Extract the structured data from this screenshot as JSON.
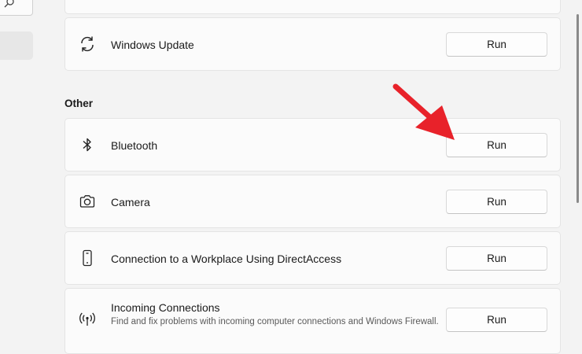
{
  "section_heading": "Other",
  "troubleshooters": [
    {
      "title": "Windows Update",
      "icon": "refresh-icon",
      "button": "Run"
    },
    {
      "title": "Bluetooth",
      "icon": "bluetooth-icon",
      "button": "Run"
    },
    {
      "title": "Camera",
      "icon": "camera-icon",
      "button": "Run"
    },
    {
      "title": "Connection to a Workplace Using DirectAccess",
      "icon": "phone-device-icon",
      "button": "Run"
    },
    {
      "title": "Incoming Connections",
      "description": "Find and fix problems with incoming computer connections and Windows Firewall.",
      "icon": "antenna-icon",
      "button": "Run"
    }
  ],
  "colors": {
    "annotation_arrow": "#e8222a",
    "card_bg": "#fbfbfb",
    "page_bg": "#f3f3f3"
  }
}
